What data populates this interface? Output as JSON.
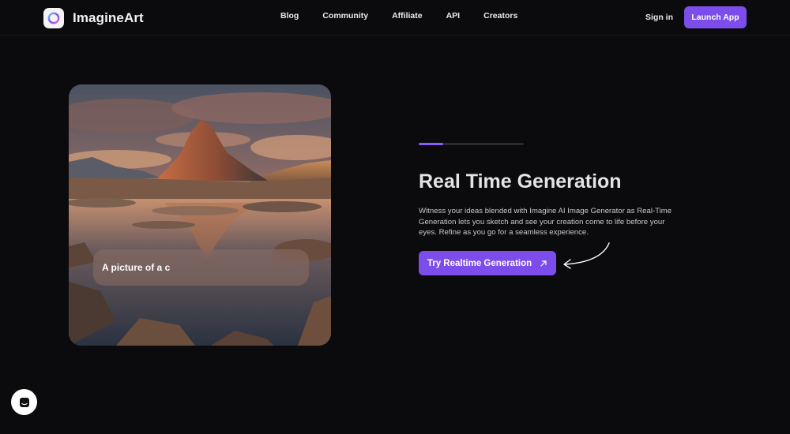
{
  "brand": {
    "name": "ImagineArt"
  },
  "nav": {
    "links": [
      {
        "label": "Blog"
      },
      {
        "label": "Community"
      },
      {
        "label": "Affiliate"
      },
      {
        "label": "API"
      },
      {
        "label": "Creators"
      }
    ],
    "signin": "Sign in",
    "launch": "Launch App"
  },
  "hero": {
    "prompt_text": "A picture of a c",
    "progress": 0.23,
    "title": "Real Time Generation",
    "description": "Witness your ideas blended with Imagine AI Image Generator as Real-Time Generation lets you sketch and see your creation come to life before your eyes. Refine as you go for a seamless experience.",
    "cta": "Try Realtime Generation"
  },
  "colors": {
    "accent": "#7c4dea",
    "background": "#0b0b0d"
  },
  "icons": {
    "cta": "arrow-up-right-icon",
    "chat": "chat-icon",
    "pointer": "curved-arrow-icon"
  }
}
